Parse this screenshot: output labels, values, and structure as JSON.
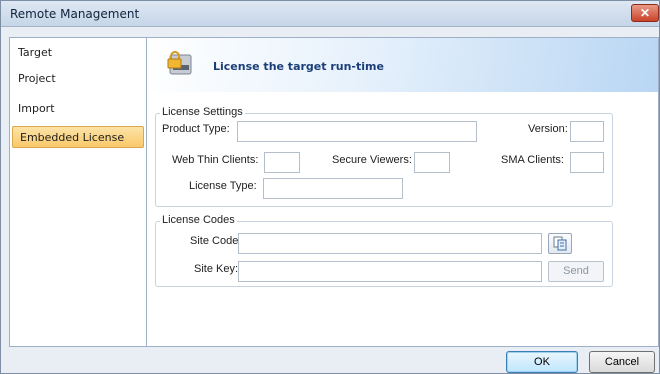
{
  "window": {
    "title": "Remote Management",
    "close_label": "✕"
  },
  "sidebar": {
    "items": [
      {
        "label": "Target",
        "active": false
      },
      {
        "label": "Project",
        "active": false
      },
      {
        "label": "Import",
        "active": false
      },
      {
        "label": "Embedded License",
        "active": true
      }
    ]
  },
  "header": {
    "icon": "lock-icon",
    "title": "License the target run-time"
  },
  "license_settings": {
    "legend": "License Settings",
    "product_type_label": "Product Type:",
    "product_type_value": "",
    "version_label": "Version:",
    "version_value": "",
    "web_thin_clients_label": "Web Thin Clients:",
    "web_thin_clients_value": "",
    "secure_viewers_label": "Secure Viewers:",
    "secure_viewers_value": "",
    "sma_clients_label": "SMA Clients:",
    "sma_clients_value": "",
    "license_type_label": "License Type:",
    "license_type_value": ""
  },
  "license_codes": {
    "legend": "License Codes",
    "site_code_label": "Site Code:",
    "site_code_value": "",
    "copy_icon": "copy-icon",
    "site_key_label": "Site Key:",
    "site_key_value": "",
    "send_label": "Send"
  },
  "footer": {
    "ok_label": "OK",
    "cancel_label": "Cancel"
  },
  "colors": {
    "accent": "#f9c96b",
    "header_gradient_end": "#b9d6f3",
    "title_text": "#1b3e78"
  }
}
